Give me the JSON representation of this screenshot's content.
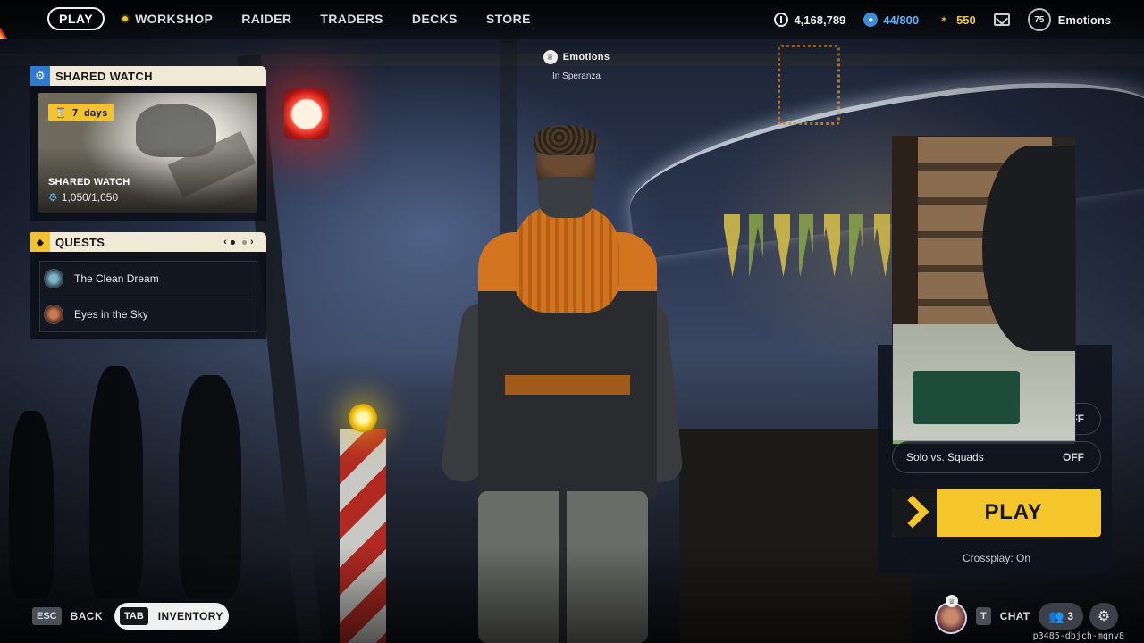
{
  "nav": {
    "play": "PLAY",
    "items": [
      "WORKSHOP",
      "RAIDER",
      "TRADERS",
      "DECKS",
      "STORE"
    ]
  },
  "currencies": {
    "coins": "4,168,789",
    "blue": "44/800",
    "gold": "550"
  },
  "profile": {
    "level": "75",
    "username": "Emotions"
  },
  "location": {
    "name": "Emotions",
    "place": "In Speranza"
  },
  "shared_watch": {
    "header": "SHARED WATCH",
    "days": "7 days",
    "card_title": "SHARED WATCH",
    "progress": "1,050/1,050"
  },
  "quests": {
    "header": "QUESTS",
    "page_current": 1,
    "page_total": 2,
    "items": [
      "The Clean Dream",
      "Eyes in the Sky"
    ]
  },
  "match": {
    "toggle1_value": "OFF",
    "toggle2_label": "Solo vs. Squads",
    "toggle2_value": "OFF",
    "play": "PLAY",
    "crossplay": "Crossplay: On"
  },
  "bottom": {
    "esc_key": "ESC",
    "back": "BACK",
    "tab_key": "TAB",
    "inventory": "INVENTORY",
    "chat_key": "T",
    "chat": "CHAT",
    "friends_count": "3",
    "build": "p3485-dbjch-mqnv8"
  },
  "colors": {
    "accent_yellow": "#f5c52c",
    "blue_currency": "#5fb0ff",
    "gold_currency": "#f4c53a",
    "panel_header": "#efe9d6"
  },
  "icons": [
    "rainbow-logo-icon",
    "workshop-dot-icon",
    "coin-icon",
    "blue-currency-icon",
    "gold-currency-icon",
    "mail-icon",
    "crown-icon",
    "gear-icon",
    "hourglass-icon",
    "quest-diamond-icon",
    "chevron-left-icon",
    "chevron-right-icon",
    "play-chevron-icon",
    "friends-icon",
    "settings-icon"
  ]
}
